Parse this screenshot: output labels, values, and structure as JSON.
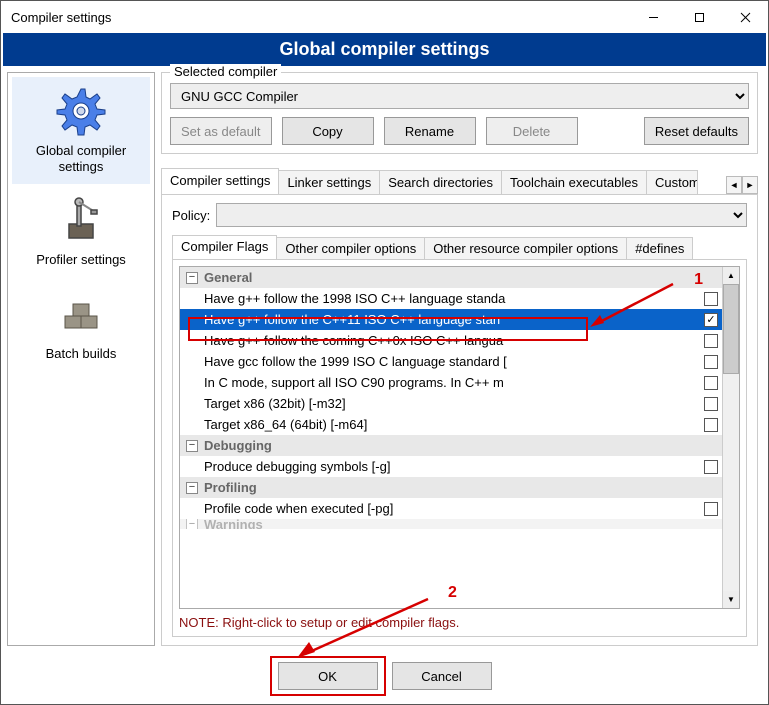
{
  "window": {
    "title": "Compiler settings"
  },
  "banner": "Global compiler settings",
  "sidebar": {
    "items": [
      {
        "label": "Global compiler settings"
      },
      {
        "label": "Profiler settings"
      },
      {
        "label": "Batch builds"
      }
    ]
  },
  "selected_compiler": {
    "group_title": "Selected compiler",
    "value": "GNU GCC Compiler",
    "buttons": {
      "set_default": "Set as default",
      "copy": "Copy",
      "rename": "Rename",
      "delete": "Delete",
      "reset": "Reset defaults"
    }
  },
  "outer_tabs": [
    "Compiler settings",
    "Linker settings",
    "Search directories",
    "Toolchain executables",
    "Custom"
  ],
  "policy_label": "Policy:",
  "inner_tabs": [
    "Compiler Flags",
    "Other compiler options",
    "Other resource compiler options",
    "#defines"
  ],
  "flag_groups": {
    "general": "General",
    "debugging": "Debugging",
    "profiling": "Profiling",
    "warnings": "Warnings"
  },
  "flags": {
    "general": [
      {
        "label": "Have g++ follow the 1998 ISO C++ language standa",
        "checked": false
      },
      {
        "label": "Have g++ follow the C++11 ISO C++ language stan",
        "checked": true,
        "selected": true
      },
      {
        "label": "Have g++ follow the coming C++0x ISO C++ langua",
        "checked": false
      },
      {
        "label": "Have gcc follow the 1999 ISO C language standard  [",
        "checked": false
      },
      {
        "label": "In C mode, support all ISO C90 programs. In C++ m",
        "checked": false
      },
      {
        "label": "Target x86 (32bit)  [-m32]",
        "checked": false
      },
      {
        "label": "Target x86_64 (64bit)  [-m64]",
        "checked": false
      }
    ],
    "debugging": [
      {
        "label": "Produce debugging symbols  [-g]",
        "checked": false
      }
    ],
    "profiling": [
      {
        "label": "Profile code when executed  [-pg]",
        "checked": false
      }
    ]
  },
  "note": "NOTE: Right-click to setup or edit compiler flags.",
  "footer": {
    "ok": "OK",
    "cancel": "Cancel"
  },
  "annotations": {
    "num1": "1",
    "num2": "2"
  }
}
